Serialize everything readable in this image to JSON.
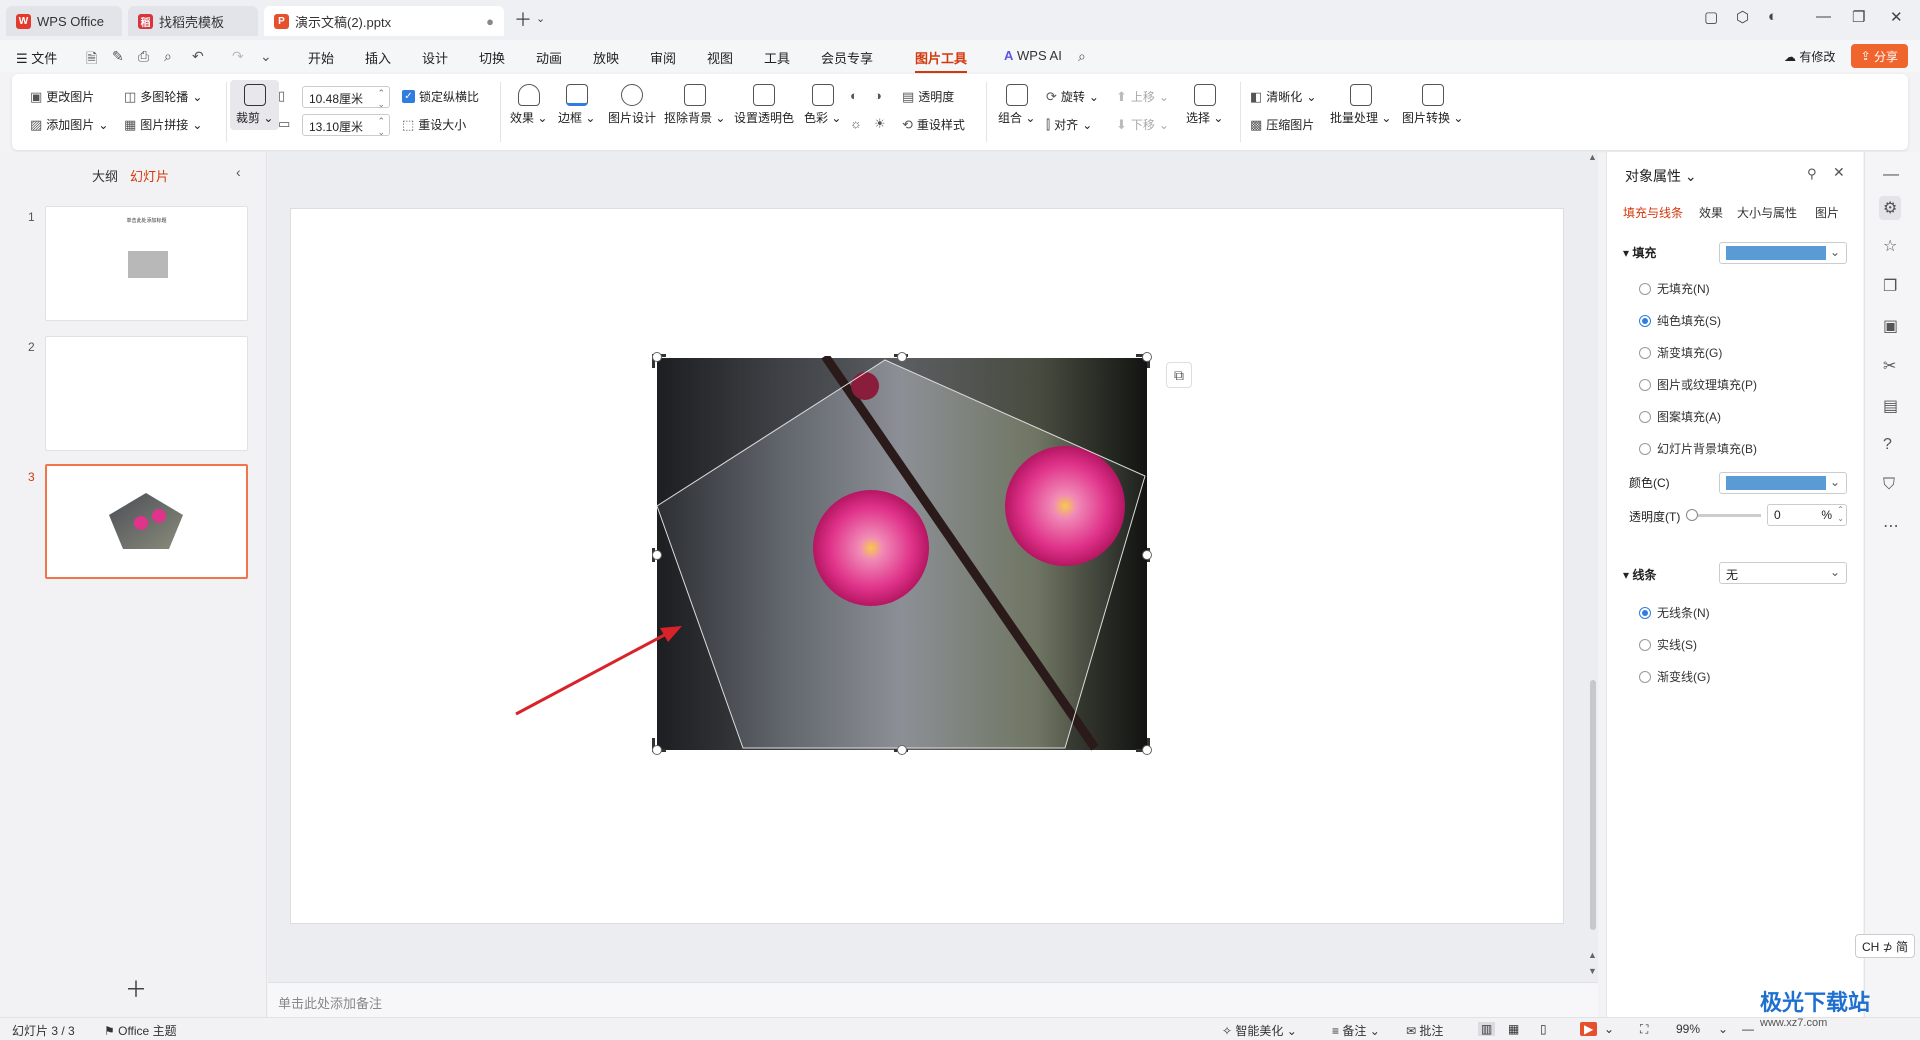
{
  "tabs": [
    {
      "label": "WPS Office",
      "logo": "W",
      "color": "#e03b2d"
    },
    {
      "label": "找稻壳模板",
      "logo": "稻",
      "color": "#d7343c"
    },
    {
      "label": "演示文稿(2).pptx",
      "logo": "P",
      "color": "#e5502e"
    }
  ],
  "menu": {
    "file": "文件",
    "items": [
      "开始",
      "插入",
      "设计",
      "切换",
      "动画",
      "放映",
      "审阅",
      "视图",
      "工具",
      "会员专享",
      "图片工具"
    ],
    "active": "图片工具",
    "ai": "WPS AI",
    "modified": "有修改",
    "share": "分享"
  },
  "ribbon": {
    "change_picture": "更改图片",
    "add_picture": "添加图片",
    "multi_carousel": "多图轮播",
    "picture_collage": "图片拼接",
    "crop": "裁剪",
    "width": "10.48厘米",
    "height": "13.10厘米",
    "lock_ratio": "锁定纵横比",
    "reset_size": "重设大小",
    "effects": "效果",
    "border": "边框",
    "picture_design": "图片设计",
    "remove_bg": "抠除背景",
    "set_transparent": "设置透明色",
    "color": "色彩",
    "transparency": "透明度",
    "reset_style": "重设样式",
    "group": "组合",
    "rotate": "旋转",
    "align": "对齐",
    "bring_forward": "上移",
    "send_backward": "下移",
    "select": "选择",
    "sharpen": "清晰化",
    "compress": "压缩图片",
    "batch": "批量处理",
    "convert": "图片转换"
  },
  "left_pane": {
    "tab_outline": "大纲",
    "tab_slides": "幻灯片",
    "slides": [
      {
        "num": "1",
        "title": "单击此处添加标题"
      },
      {
        "num": "2"
      },
      {
        "num": "3"
      }
    ]
  },
  "notes_placeholder": "单击此处添加备注",
  "right_pane": {
    "title": "对象属性",
    "tabs": [
      "填充与线条",
      "效果",
      "大小与属性",
      "图片"
    ],
    "fill_section": "填充",
    "fill_options": [
      "无填充(N)",
      "纯色填充(S)",
      "渐变填充(G)",
      "图片或纹理填充(P)",
      "图案填充(A)",
      "幻灯片背景填充(B)"
    ],
    "fill_selected": 1,
    "color_label": "颜色(C)",
    "fill_color": "#5b9bd5",
    "transparency_label": "透明度(T)",
    "transparency_value": "0",
    "transparency_unit": "%",
    "line_section": "线条",
    "line_value": "无",
    "line_options": [
      "无线条(N)",
      "实线(S)",
      "渐变线(G)"
    ],
    "line_selected": 0
  },
  "status": {
    "slide_count": "幻灯片 3 / 3",
    "theme": "Office 主题",
    "beautify": "智能美化",
    "notes": "备注",
    "comment": "批注",
    "zoom": "99%"
  },
  "ime": "CH ⊅ 简",
  "watermark": {
    "brand": "极光下载站",
    "url": "www.xz7.com"
  }
}
